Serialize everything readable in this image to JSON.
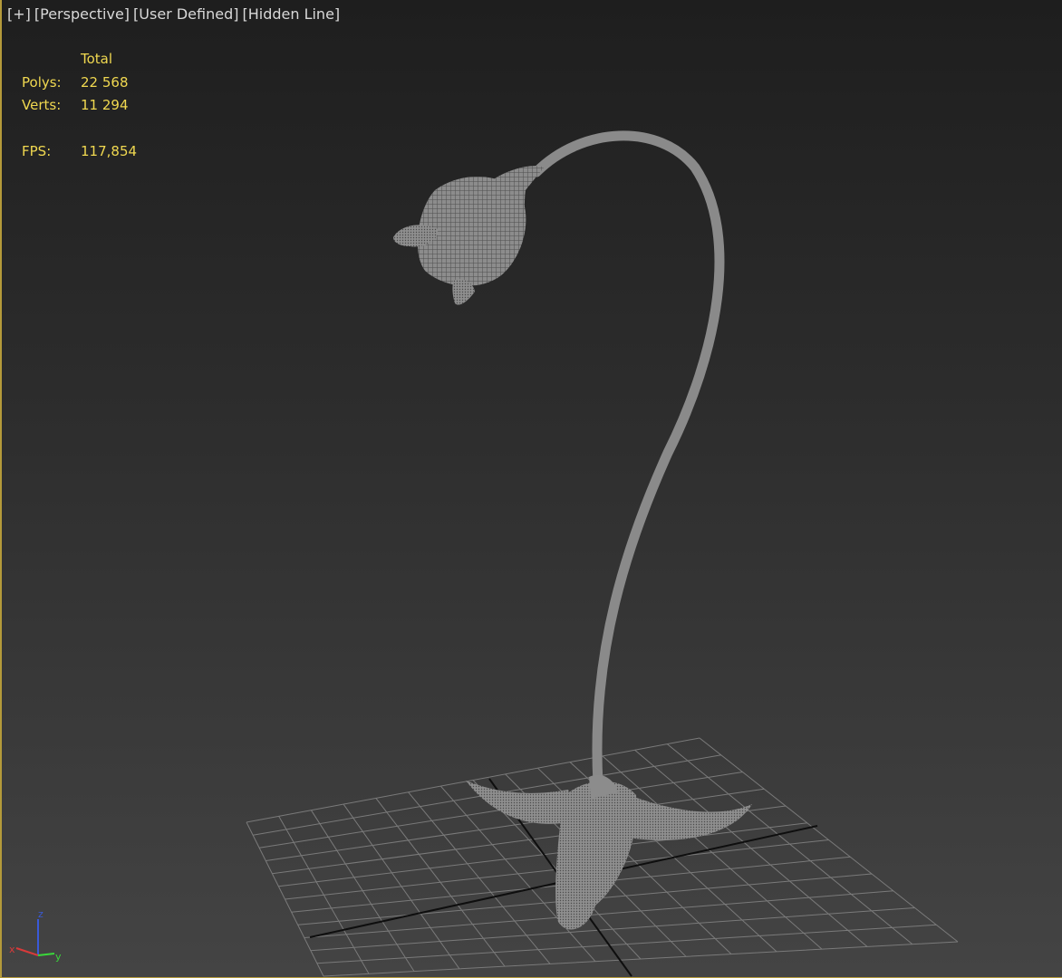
{
  "viewport": {
    "labels": [
      "[+]",
      "[Perspective]",
      "[User Defined]",
      "[Hidden Line]"
    ]
  },
  "stats": {
    "header": "Total",
    "rows": [
      {
        "key": "Polys:",
        "value": "22 568"
      },
      {
        "key": "Verts:",
        "value": "11 294"
      }
    ],
    "fps_label": "FPS:",
    "fps_value": "117,854"
  },
  "gizmo": {
    "z": "z",
    "x": "x",
    "y": "y",
    "colors": {
      "z": "#3a5ad8",
      "x": "#d83a3a",
      "y": "#3ad83a"
    }
  },
  "colors": {
    "accent_border": "#b49a3a",
    "stats_text": "#f0d850",
    "model_gray": "#8a8a8a"
  }
}
